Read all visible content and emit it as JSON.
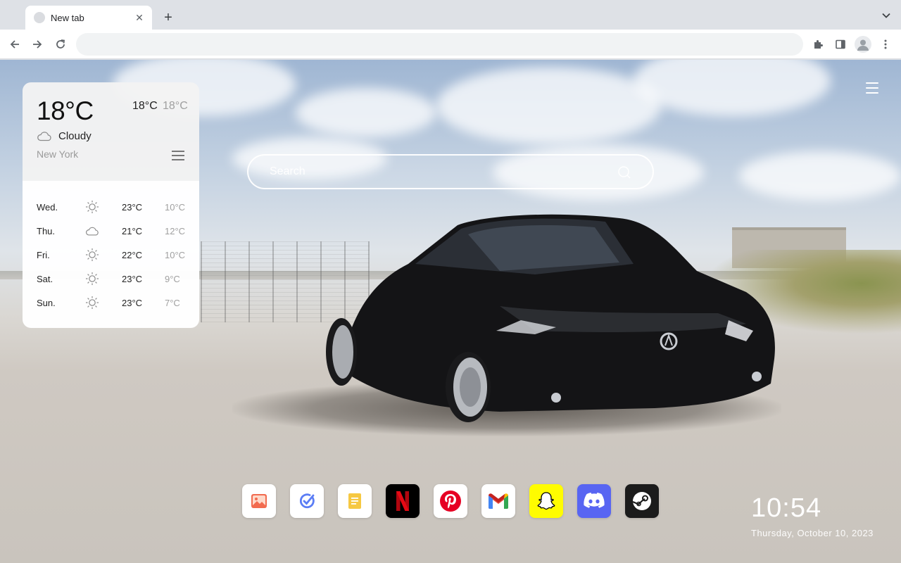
{
  "browser": {
    "tab_title": "New tab",
    "tab_close": "✕",
    "new_tab": "+",
    "address_value": ""
  },
  "weather": {
    "current_temp": "18°C",
    "high": "18°C",
    "low": "18°C",
    "condition": "Cloudy",
    "condition_icon": "cloud-icon",
    "city": "New York",
    "forecast": [
      {
        "day": "Wed.",
        "icon": "sun-icon",
        "high": "23°C",
        "low": "10°C"
      },
      {
        "day": "Thu.",
        "icon": "cloud-icon",
        "high": "21°C",
        "low": "12°C"
      },
      {
        "day": "Fri.",
        "icon": "sun-icon",
        "high": "22°C",
        "low": "10°C"
      },
      {
        "day": "Sat.",
        "icon": "sun-icon",
        "high": "23°C",
        "low": "9°C"
      },
      {
        "day": "Sun.",
        "icon": "sun-icon",
        "high": "23°C",
        "low": "7°C"
      }
    ]
  },
  "search": {
    "placeholder": "Search"
  },
  "dock": [
    {
      "name": "photos-app",
      "icon": "image-icon",
      "bg": "#ffffff"
    },
    {
      "name": "tasks-app",
      "icon": "check-circle-icon",
      "bg": "#ffffff"
    },
    {
      "name": "notes-app",
      "icon": "note-icon",
      "bg": "#ffffff"
    },
    {
      "name": "netflix-app",
      "icon": "netflix-icon",
      "bg": "#000000"
    },
    {
      "name": "pinterest-app",
      "icon": "pinterest-icon",
      "bg": "#ffffff"
    },
    {
      "name": "gmail-app",
      "icon": "gmail-icon",
      "bg": "#ffffff"
    },
    {
      "name": "snapchat-app",
      "icon": "snapchat-icon",
      "bg": "#fffc00"
    },
    {
      "name": "discord-app",
      "icon": "discord-icon",
      "bg": "#5865f2"
    },
    {
      "name": "steam-app",
      "icon": "steam-icon",
      "bg": "#1b1b1b"
    }
  ],
  "clock": {
    "time": "10:54",
    "date": "Thursday, October 10, 2023"
  }
}
